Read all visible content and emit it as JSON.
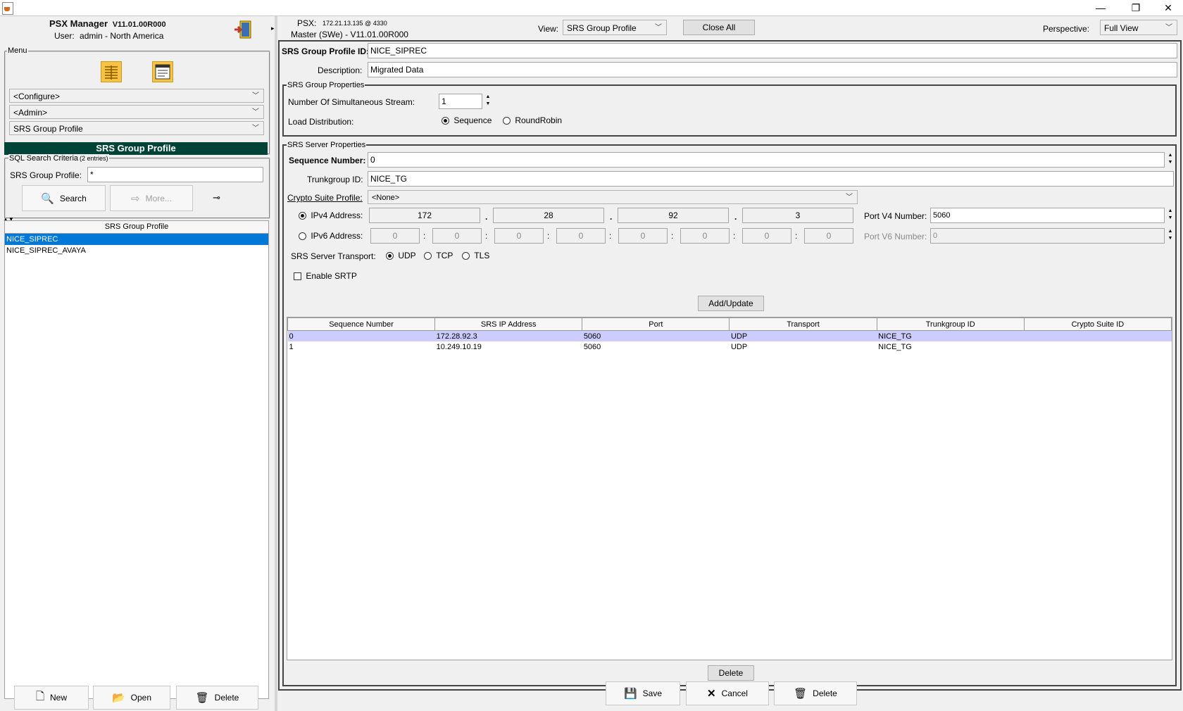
{
  "window": {
    "minimize": "—",
    "restore": "❐",
    "close": "✕"
  },
  "app": {
    "name": "PSX Manager",
    "version": "V11.01.00R000",
    "user_label": "User:",
    "user_value": "admin - North America"
  },
  "menu": {
    "legend": "Menu",
    "dropdowns": [
      "<Configure>",
      "<Admin>",
      "SRS Group Profile"
    ]
  },
  "left": {
    "header": "SRS Group Profile",
    "criteria_legend": "SQL Search Criteria",
    "criteria_count": "(2 entries)",
    "search_field_label": "SRS Group Profile:",
    "search_field_value": "*",
    "search_button": "Search",
    "more_button": "More...",
    "list_header": "SRS Group Profile",
    "list_items": [
      "NICE_SIPREC",
      "NICE_SIPREC_AVAYA"
    ],
    "new_button": "New",
    "open_button": "Open",
    "delete_button": "Delete"
  },
  "header": {
    "psx_label": "PSX:",
    "psx_value": "172.21.13.135 @ 4330",
    "master_label": "Master (SWe) - V11.01.00R000",
    "view_label": "View:",
    "view_value": "SRS Group Profile",
    "close_all": "Close All",
    "perspective_label": "Perspective:",
    "perspective_value": "Full View"
  },
  "form": {
    "id_label": "SRS Group Profile ID:",
    "id_value": "NICE_SIPREC",
    "description_label": "Description:",
    "description_value": "Migrated Data",
    "group_props_legend": "SRS Group Properties",
    "streams_label": "Number Of Simultaneous Stream:",
    "streams_value": "1",
    "load_dist_label": "Load Distribution:",
    "sequence_label": "Sequence",
    "roundrobin_label": "RoundRobin",
    "server_props_legend": "SRS Server Properties",
    "seq_label": "Sequence Number:",
    "seq_value": "0",
    "trunk_label": "Trunkgroup ID:",
    "trunk_value": "NICE_TG",
    "crypto_label": "Crypto Suite Profile:",
    "crypto_value": "<None>",
    "ipv4_label": "IPv4 Address:",
    "ipv4_octets": [
      "172",
      "28",
      "92",
      "3"
    ],
    "port_v4_label": "Port V4 Number:",
    "port_v4_value": "5060",
    "ipv6_label": "IPv6 Address:",
    "ipv6_groups": [
      "0",
      "0",
      "0",
      "0",
      "0",
      "0",
      "0",
      "0"
    ],
    "port_v6_label": "Port V6 Number:",
    "port_v6_value": "0",
    "transport_label": "SRS Server Transport:",
    "udp": "UDP",
    "tcp": "TCP",
    "tls": "TLS",
    "srtp_label": "Enable SRTP",
    "add_update": "Add/Update",
    "table_delete": "Delete"
  },
  "table": {
    "columns": [
      "Sequence Number",
      "SRS IP Address",
      "Port",
      "Transport",
      "Trunkgroup ID",
      "Crypto Suite ID"
    ],
    "rows": [
      [
        "0",
        "172.28.92.3",
        "5060",
        "UDP",
        "NICE_TG",
        ""
      ],
      [
        "1",
        "10.249.10.19",
        "5060",
        "UDP",
        "NICE_TG",
        ""
      ]
    ]
  },
  "footer": {
    "save": "Save",
    "cancel": "Cancel",
    "delete": "Delete"
  },
  "colors": {
    "selection": "#0078d7",
    "header_green": "#004438",
    "row_highlight": "#ccccff"
  }
}
